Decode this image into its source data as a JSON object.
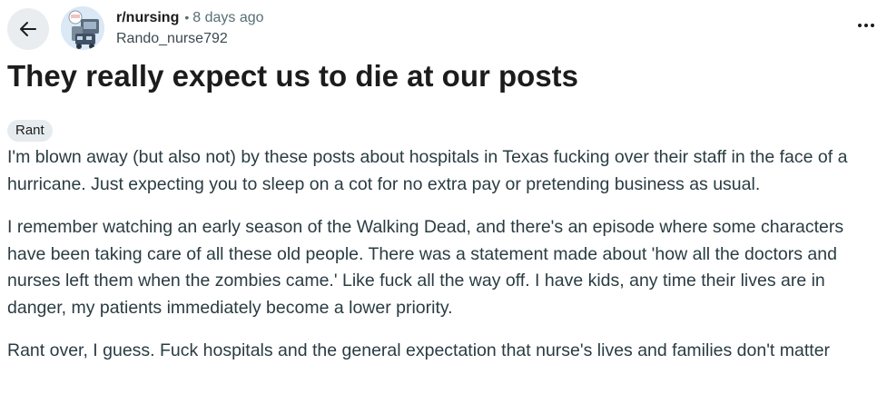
{
  "header": {
    "back_icon": "arrow-left-icon",
    "subreddit": "r/nursing",
    "separator": "•",
    "time_ago": "8 days ago",
    "author": "Rando_nurse792",
    "more_icon": "more-horizontal-icon"
  },
  "post": {
    "title": "They really expect us to die at our posts",
    "flair": "Rant",
    "paragraphs": [
      "I'm blown away (but also not) by these posts about hospitals in Texas fucking over their staff in the face of a hurricane. Just expecting you to sleep on a cot for no extra pay or pretending business as usual.",
      "I remember watching an early season of the Walking Dead, and there's an episode where some characters have been taking care of all these old people. There was a statement made about 'how all the doctors and nurses left them when the zombies came.' Like fuck all the way off. I have kids, any time their lives are in danger, my patients immediately become a lower priority.",
      "Rant over, I guess. Fuck hospitals and the general expectation that nurse's lives and families don't matter"
    ]
  },
  "colors": {
    "back_button_bg": "#eaedef",
    "flair_bg": "#e5ebee",
    "meta_gray": "#576f76",
    "text": "#1c1c1c"
  }
}
